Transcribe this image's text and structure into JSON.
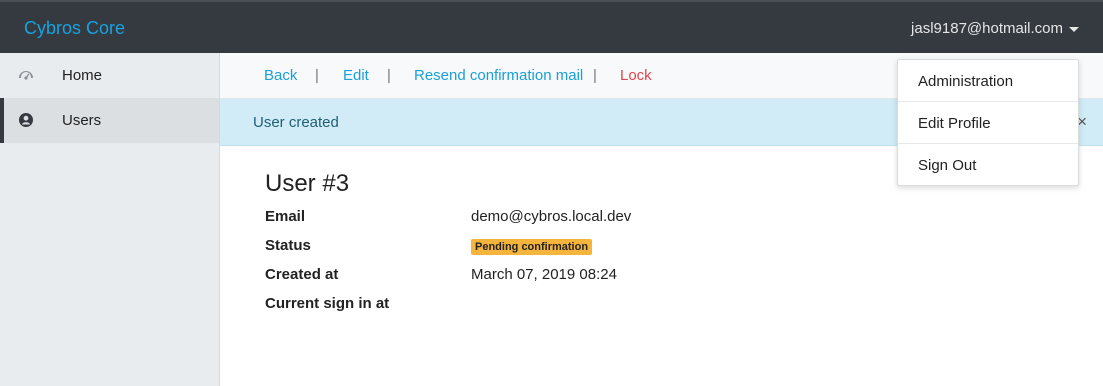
{
  "navbar": {
    "brand": "Cybros Core",
    "user_email": "jasl9187@hotmail.com"
  },
  "sidebar": {
    "items": [
      {
        "label": "Home",
        "icon": "dashboard-icon",
        "active": false
      },
      {
        "label": "Users",
        "icon": "user-circle-icon",
        "active": true
      }
    ]
  },
  "actions": {
    "back": "Back",
    "edit": "Edit",
    "resend": "Resend confirmation mail",
    "lock": "Lock",
    "separator": "|"
  },
  "alert": {
    "message": "User created",
    "close": "×"
  },
  "user": {
    "title": "User #3",
    "fields": [
      {
        "label": "Email",
        "value": "demo@cybros.local.dev"
      },
      {
        "label": "Status",
        "value": "Pending confirmation"
      },
      {
        "label": "Created at",
        "value": "March 07, 2019 08:24"
      },
      {
        "label": "Current sign in at",
        "value": ""
      }
    ]
  },
  "dropdown": {
    "items": [
      "Administration",
      "Edit Profile",
      "Sign Out"
    ]
  },
  "colors": {
    "navbar": "#343a40",
    "brand": "#17a2e0",
    "link": "#1a9fd6",
    "danger": "#e0474c",
    "alert_bg": "#d1ecf6",
    "badge": "#f5b43c"
  }
}
